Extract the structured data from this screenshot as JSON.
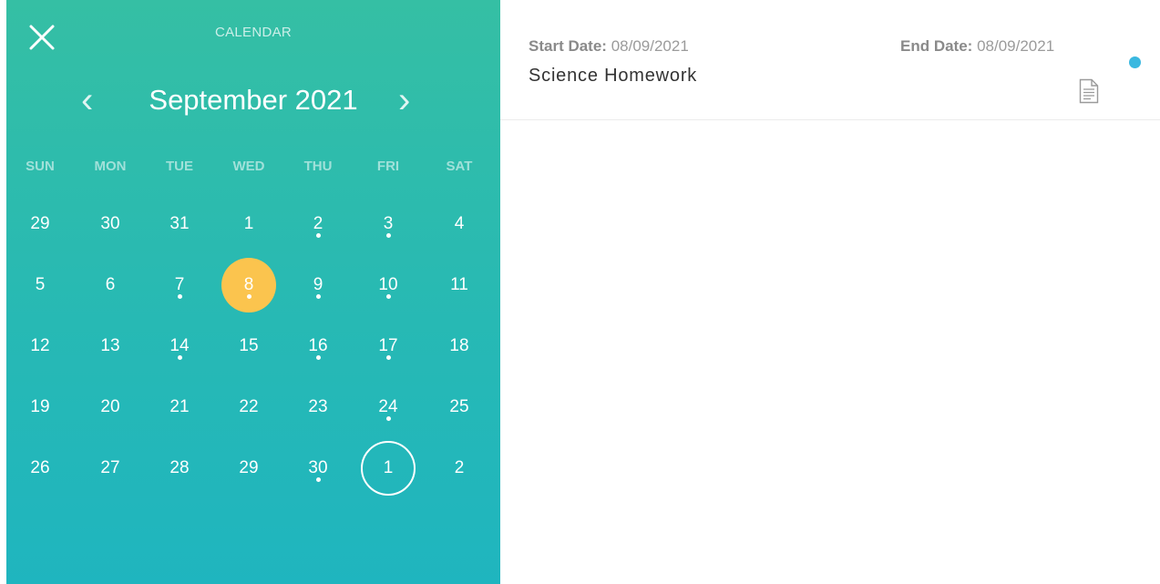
{
  "calendar": {
    "header_title": "CALENDAR",
    "month_label": "September 2021",
    "prev_glyph": "‹",
    "next_glyph": "›",
    "weekdays": [
      "SUN",
      "MON",
      "TUE",
      "WED",
      "THU",
      "FRI",
      "SAT"
    ],
    "weeks": [
      [
        {
          "d": "29"
        },
        {
          "d": "30"
        },
        {
          "d": "31"
        },
        {
          "d": "1"
        },
        {
          "d": "2",
          "event": true
        },
        {
          "d": "3",
          "event": true
        },
        {
          "d": "4"
        }
      ],
      [
        {
          "d": "5"
        },
        {
          "d": "6"
        },
        {
          "d": "7",
          "event": true
        },
        {
          "d": "8",
          "event": true,
          "selected": true
        },
        {
          "d": "9",
          "event": true
        },
        {
          "d": "10",
          "event": true
        },
        {
          "d": "11"
        }
      ],
      [
        {
          "d": "12"
        },
        {
          "d": "13"
        },
        {
          "d": "14",
          "event": true
        },
        {
          "d": "15"
        },
        {
          "d": "16",
          "event": true
        },
        {
          "d": "17",
          "event": true
        },
        {
          "d": "18"
        }
      ],
      [
        {
          "d": "19"
        },
        {
          "d": "20"
        },
        {
          "d": "21"
        },
        {
          "d": "22"
        },
        {
          "d": "23"
        },
        {
          "d": "24",
          "event": true
        },
        {
          "d": "25"
        }
      ],
      [
        {
          "d": "26"
        },
        {
          "d": "27"
        },
        {
          "d": "28"
        },
        {
          "d": "29"
        },
        {
          "d": "30",
          "event": true
        },
        {
          "d": "1",
          "today": true
        },
        {
          "d": "2"
        }
      ]
    ],
    "colors": {
      "selected": "#fbc44e",
      "gradient_top": "#35bfa4",
      "gradient_bottom": "#1fb5bf"
    }
  },
  "event": {
    "start_label": "Start Date:",
    "start_value": "08/09/2021",
    "end_label": "End Date:",
    "end_value": "08/09/2021",
    "title": "Science Homework",
    "status_color": "#3ab8e0",
    "icon": "document-icon"
  }
}
